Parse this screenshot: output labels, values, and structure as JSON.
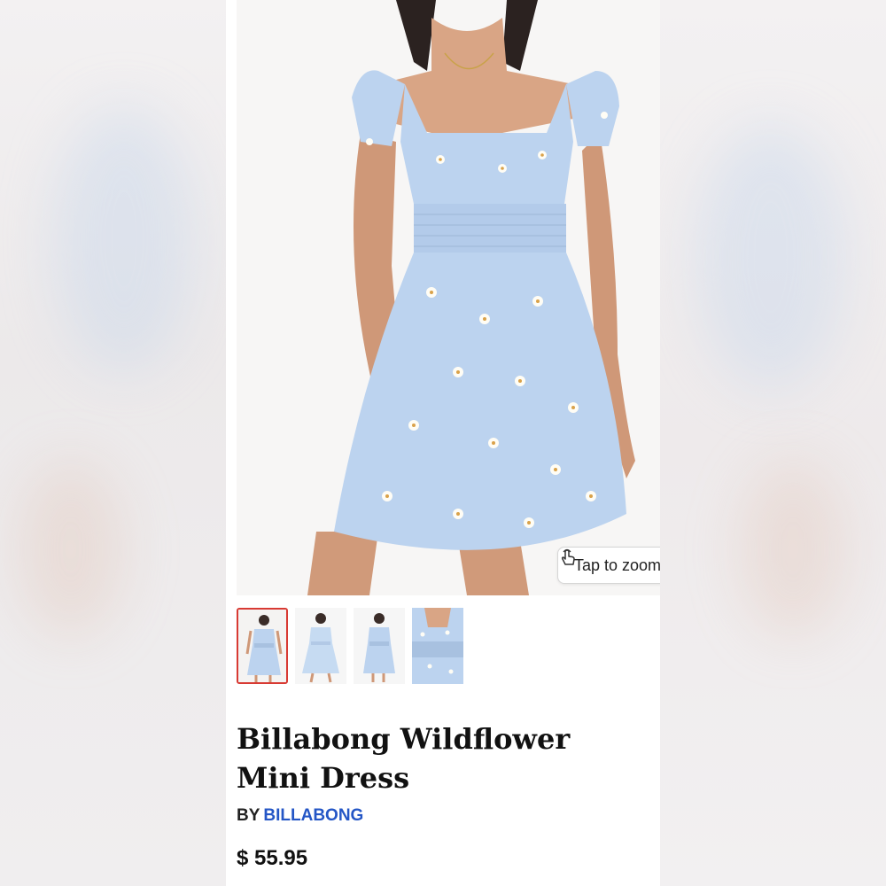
{
  "product": {
    "title": "Billabong Wildflower Mini Dress",
    "by_label": "BY",
    "brand": "BILLABONG",
    "price": "$ 55.95"
  },
  "gallery": {
    "zoom_hint": "Tap to zoom",
    "zoom_icon": "tap-hand-icon",
    "thumbnails": [
      {
        "view": "front",
        "selected": true
      },
      {
        "view": "back",
        "selected": false
      },
      {
        "view": "front-alt",
        "selected": false
      },
      {
        "view": "detail",
        "selected": false
      }
    ]
  },
  "colors": {
    "dress": "#bcd3ef",
    "brand_link": "#2456c6",
    "selected_border": "#d83a33"
  }
}
